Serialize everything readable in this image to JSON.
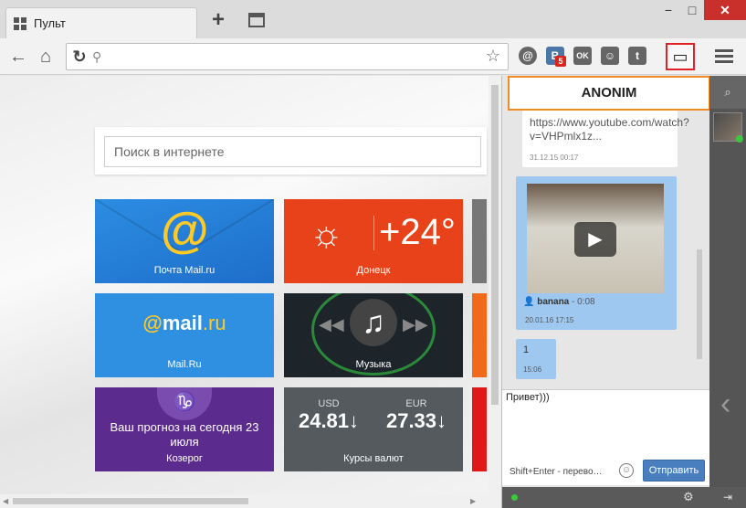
{
  "window": {
    "tab_title": "Пульт",
    "new_tab": "+",
    "minimize": "−",
    "maximize": "□",
    "close": "✕"
  },
  "toolbar": {
    "back": "←",
    "home": "⌂",
    "reload": "↻",
    "address_value": "",
    "bookmark_star": "☆",
    "extensions": {
      "mail": "@",
      "vk": "B",
      "vk_badge": "5",
      "ok": "OK",
      "smile": "☺",
      "twitter": "t"
    },
    "chat_icon": "💬"
  },
  "content": {
    "search_placeholder": "Поиск в интернете",
    "tiles": {
      "mail": {
        "label": "Почта Mail.ru",
        "glyph": "@"
      },
      "weather": {
        "label": "Донецк",
        "temp": "+24°",
        "sun": "☼"
      },
      "mailru": {
        "label": "Mail.Ru",
        "logo_at": "@",
        "logo_mail": "mail",
        "logo_ru": ".ru"
      },
      "music": {
        "label": "Музыка",
        "note": "♫",
        "prev": "◀◀",
        "next": "▶▶"
      },
      "horoscope": {
        "label": "Козерог",
        "text": "Ваш прогноз на сегодня 23 июля",
        "sign": "♑"
      },
      "currency": {
        "label": "Курсы валют",
        "usd_code": "USD",
        "usd_value": "24.81↓",
        "eur_code": "EUR",
        "eur_value": "27.33↓"
      }
    }
  },
  "chat": {
    "contact_name": "ANONIM",
    "messages": [
      {
        "text": "https://www.youtube.com/watch?v=VHPmlx1z...",
        "time": "31.12.15 00:17"
      },
      {
        "sender": "banana",
        "duration": "- 0:08",
        "time": "20.01.16 17:15"
      },
      {
        "text": "1",
        "time": "15:06"
      }
    ],
    "input_value": "Привет)))",
    "hint": "Shift+Enter - перево…",
    "send_label": "Отправить",
    "play": "▶",
    "smile": "☺",
    "gear": "⚙"
  },
  "sidebar": {
    "search": "⌕",
    "collapse": "‹",
    "exit": "⇥"
  },
  "colors": {
    "chat_highlight": "#e0212a",
    "chat_header_border": "#f08a24",
    "send_button": "#4a7fbf",
    "online": "#3cc83c"
  }
}
